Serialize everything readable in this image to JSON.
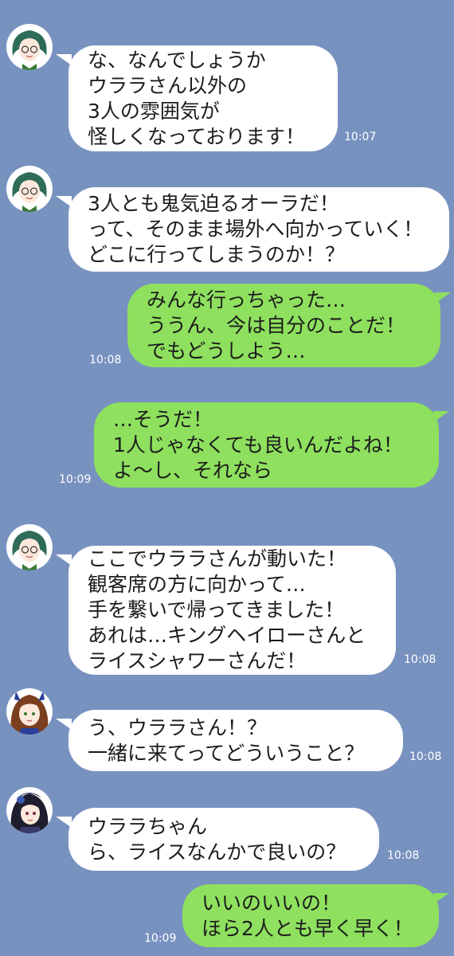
{
  "messages": [
    {
      "side": "left",
      "avatar": "announcer-avatar",
      "lines": [
        "な、なんでしょうか",
        "ウララさん以外の",
        "3人の雰囲気が",
        "怪しくなっております！"
      ],
      "time": "10:07"
    },
    {
      "side": "left",
      "avatar": "announcer-avatar",
      "lines": [
        "3人とも鬼気迫るオーラだ！",
        "って、そのまま場外へ向かっていく！",
        "どこに行ってしまうのか！？"
      ],
      "time": ""
    },
    {
      "side": "right",
      "lines": [
        "みんな行っちゃった…",
        "ううん、今は自分のことだ！",
        "でもどうしよう…"
      ],
      "time": "10:08"
    },
    {
      "side": "right",
      "lines": [
        "…そうだ！",
        "1人じゃなくても良いんだよね！",
        "よ〜し、それなら"
      ],
      "time": "10:09"
    },
    {
      "side": "left",
      "avatar": "announcer-avatar",
      "lines": [
        "ここでウララさんが動いた！",
        "観客席の方に向かって…",
        "手を繋いで帰ってきました！",
        "あれは…キングヘイローさんと",
        "ライスシャワーさんだ！"
      ],
      "time": "10:08"
    },
    {
      "side": "left",
      "avatar": "king-halo-avatar",
      "lines": [
        "う、ウララさん！？",
        "一緒に来てってどういうこと？"
      ],
      "time": "10:08"
    },
    {
      "side": "left",
      "avatar": "rice-shower-avatar",
      "lines": [
        "ウララちゃん",
        "ら、ライスなんかで良いの？"
      ],
      "time": "10:08"
    },
    {
      "side": "right",
      "lines": [
        "いいのいいの！",
        "ほら2人とも早く早く！"
      ],
      "time": "10:09"
    }
  ]
}
